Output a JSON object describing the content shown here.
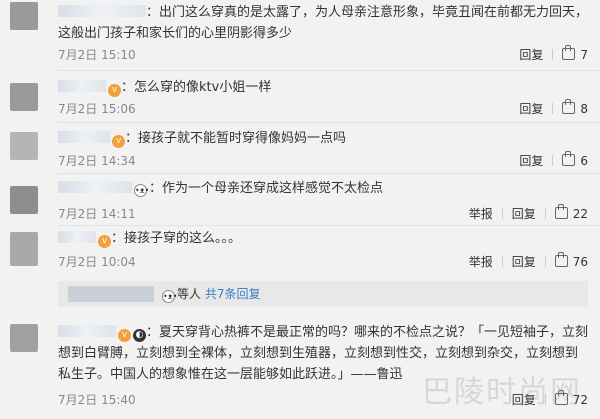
{
  "comments": [
    {
      "text": "：出门这么穿真的是太露了，为人母亲注意形象，毕竟丑闻在前都无力回天，这般出门孩子和家长们的心里阴影得多少",
      "time": "7月2日 15:10",
      "reply": "回复",
      "likes": "7"
    },
    {
      "text": "：怎么穿的像ktv小姐一样",
      "time": "7月2日 15:06",
      "reply": "回复",
      "likes": "8"
    },
    {
      "text": "：接孩子就不能暂时穿得像妈妈一点吗",
      "time": "7月2日 14:34",
      "reply": "回复",
      "likes": "6"
    },
    {
      "text": "：作为一个母亲还穿成这样感觉不太检点",
      "time": "7月2日 14:11",
      "reply": "回复",
      "report": "举报",
      "likes": "22"
    },
    {
      "text": "：接孩子穿的这么。。。",
      "time": "7月2日 10:04",
      "reply": "回复",
      "report": "举报",
      "likes": "76"
    },
    {
      "text": "：夏天穿背心热裤不是最正常的吗？哪来的不检点之说？「一见短袖子，立刻想到白臂膊，立刻想到全裸体，立刻想到生殖器，立刻想到性交，立刻想到杂交，立刻想到私生子。中国人的想象惟在这一层能够如此跃进。」——鲁迅",
      "time": "7月2日 15:40",
      "reply": "回复",
      "likes": "72"
    }
  ],
  "more_replies": {
    "prefix": "等人",
    "link": "共7条回复"
  },
  "watermark": "巴陵时尚网"
}
